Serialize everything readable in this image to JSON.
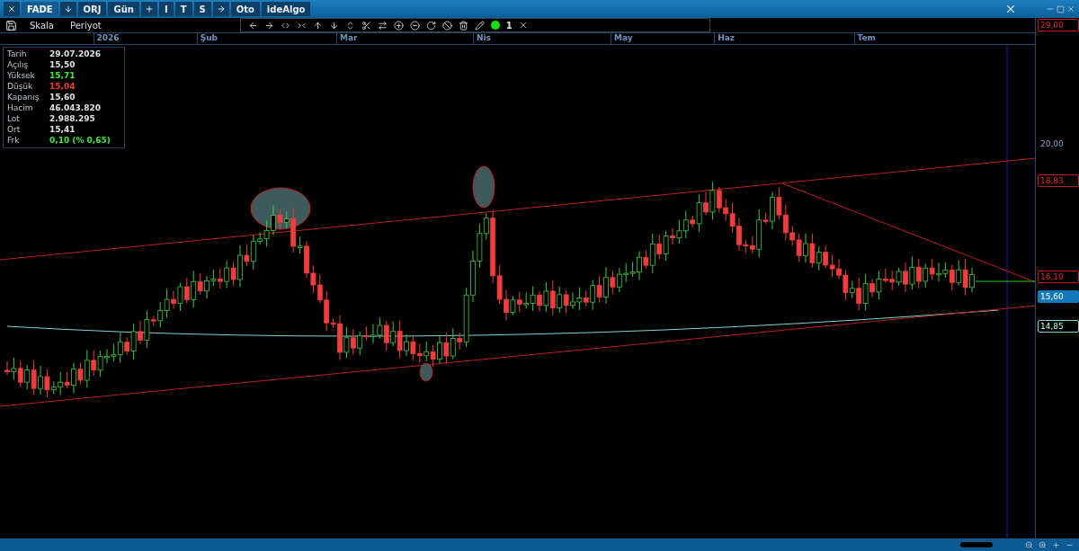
{
  "title_bar": {
    "items": [
      {
        "kind": "text",
        "label": "FADE",
        "selected": true
      },
      {
        "kind": "down-arrow"
      },
      {
        "kind": "text",
        "label": "ORJ",
        "selected": false
      },
      {
        "kind": "text",
        "label": "Gün",
        "selected": false
      },
      {
        "kind": "plus"
      },
      {
        "kind": "text",
        "label": "I",
        "selected": false
      },
      {
        "kind": "text",
        "label": "T",
        "selected": false
      },
      {
        "kind": "text",
        "label": "S",
        "selected": false
      },
      {
        "kind": "right-arrow"
      },
      {
        "kind": "text",
        "label": "Oto",
        "selected": false
      },
      {
        "kind": "text",
        "label": "ideAlgo",
        "selected": false
      }
    ]
  },
  "toolbar": {
    "buttons": [
      "Skala",
      "Periyot"
    ],
    "drawing_count": "1"
  },
  "time_axis": [
    {
      "label": "2026"
    },
    {
      "label": "Şub"
    },
    {
      "label": "Mar"
    },
    {
      "label": "Nis"
    },
    {
      "label": "May"
    },
    {
      "label": "Haz"
    },
    {
      "label": "Tem"
    }
  ],
  "info_panel": [
    {
      "label": "Tarih",
      "value": "29.07.2026",
      "color": "#e0e0e0"
    },
    {
      "label": "Açılış",
      "value": "15,50",
      "color": "#e0e0e0"
    },
    {
      "label": "Yüksek",
      "value": "15,71",
      "color": "#3ee83e"
    },
    {
      "label": "Düşük",
      "value": "15,04",
      "color": "#f03c3c"
    },
    {
      "label": "Kapanış",
      "value": "15,60",
      "color": "#e0e0e0"
    },
    {
      "label": "Hacim",
      "value": "46.043.820",
      "color": "#e0e0e0"
    },
    {
      "label": "Lot",
      "value": "2.988.295",
      "color": "#e0e0e0"
    },
    {
      "label": "Ort",
      "value": "15,41",
      "color": "#e0e0e0"
    },
    {
      "label": "Frk",
      "value": "0,10 (% 0,65)",
      "color": "#3ee83e"
    }
  ],
  "price_axis": [
    {
      "label": "29,00",
      "kind": "line"
    },
    {
      "label": "20,00",
      "kind": "plain"
    },
    {
      "label": "18,83",
      "kind": "line"
    },
    {
      "label": "16,10",
      "kind": "line"
    },
    {
      "label": "15,60",
      "kind": "last"
    },
    {
      "label": "14,85",
      "kind": "support"
    }
  ]
}
